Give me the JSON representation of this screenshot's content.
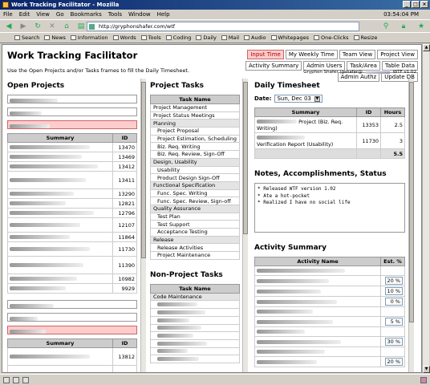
{
  "window": {
    "title": "Work Tracking Facilitator - Mozilla"
  },
  "menu": {
    "items": [
      "File",
      "Edit",
      "View",
      "Go",
      "Bookmarks",
      "Tools",
      "Window",
      "Help"
    ],
    "clock": "03:54:04 PM"
  },
  "nav": {
    "url": "http://gryphonshafer.com/wtf"
  },
  "personal_bar": [
    "Search",
    "News",
    "Information",
    "Words",
    "Tools",
    "Coding",
    "Daily",
    "Mail",
    "Audio",
    "Whitepages",
    "One-Clicks",
    "Resize"
  ],
  "page": {
    "title": "Work Tracking Facilitator",
    "subtitle": "Use the Open Projects and/or Tasks frames to fill the Daily Timesheet.",
    "tabs": [
      "Input Time",
      "My Weekly Time",
      "Team View",
      "Project View",
      "Activity Summary",
      "Admin Users",
      "Task/Area",
      "Table Data",
      "Admin Authz",
      "Update DB"
    ],
    "user": "Gryphon Shafer (gshafer@",
    "version": "WTF v1.02"
  },
  "open_projects": {
    "heading": "Open Projects",
    "columns": [
      "Summary",
      "ID"
    ],
    "ids": [
      "13470",
      "13469",
      "13412",
      "13411",
      "13290",
      "12821",
      "12796",
      "12107",
      "11864",
      "11730",
      "11390",
      "10982",
      "9929"
    ],
    "ids2": [
      "13812"
    ]
  },
  "project_tasks": {
    "heading": "Project Tasks",
    "column": "Task Name",
    "rows": [
      {
        "name": "Project Management",
        "type": "task"
      },
      {
        "name": "Project Status Meetings",
        "type": "task"
      },
      {
        "name": "Planning",
        "type": "cat"
      },
      {
        "name": "Project Proposal",
        "type": "sub"
      },
      {
        "name": "Project Estimation, Scheduling",
        "type": "sub"
      },
      {
        "name": "Biz. Req. Writing",
        "type": "sub"
      },
      {
        "name": "Biz. Req. Review, Sign-Off",
        "type": "sub"
      },
      {
        "name": "Design, Usability",
        "type": "cat"
      },
      {
        "name": "Usability",
        "type": "sub"
      },
      {
        "name": "Product Design Sign-Off",
        "type": "sub"
      },
      {
        "name": "Functional Specification",
        "type": "cat"
      },
      {
        "name": "Func. Spec. Writing",
        "type": "sub"
      },
      {
        "name": "Func. Spec. Review, Sign-off",
        "type": "sub"
      },
      {
        "name": "Quality Assurance",
        "type": "cat"
      },
      {
        "name": "Test Plan",
        "type": "sub"
      },
      {
        "name": "Test Support",
        "type": "sub"
      },
      {
        "name": "Acceptance Testing",
        "type": "sub"
      },
      {
        "name": "Release",
        "type": "cat"
      },
      {
        "name": "Release Activities",
        "type": "sub"
      },
      {
        "name": "Project Maintenance",
        "type": "sub"
      }
    ]
  },
  "non_project_tasks": {
    "heading": "Non-Project Tasks",
    "column": "Task Name",
    "first_row": "Code Maintenance"
  },
  "timesheet": {
    "heading": "Daily Timesheet",
    "date_label": "Date:",
    "date_value": "Sun, Dec 03",
    "columns": [
      "Summary",
      "ID",
      "Hours"
    ],
    "rows": [
      {
        "summary": "Project (Biz. Req. Writing)",
        "id": "13353",
        "hours": "2.5"
      },
      {
        "summary": "Verification Report (Usability)",
        "id": "11730",
        "hours": "3"
      }
    ],
    "total": "5.5"
  },
  "notes": {
    "heading": "Notes, Accomplishments, Status",
    "text": "* Released WTF version 1.02\n* Ate a hot-pocket\n* Realized I have no social life"
  },
  "activity": {
    "heading": "Activity Summary",
    "columns": [
      "Activity Name",
      "Est. %"
    ],
    "pcts": [
      "20 %",
      "10 %",
      "0 %",
      "5 %",
      "30 %",
      "20 %"
    ]
  }
}
